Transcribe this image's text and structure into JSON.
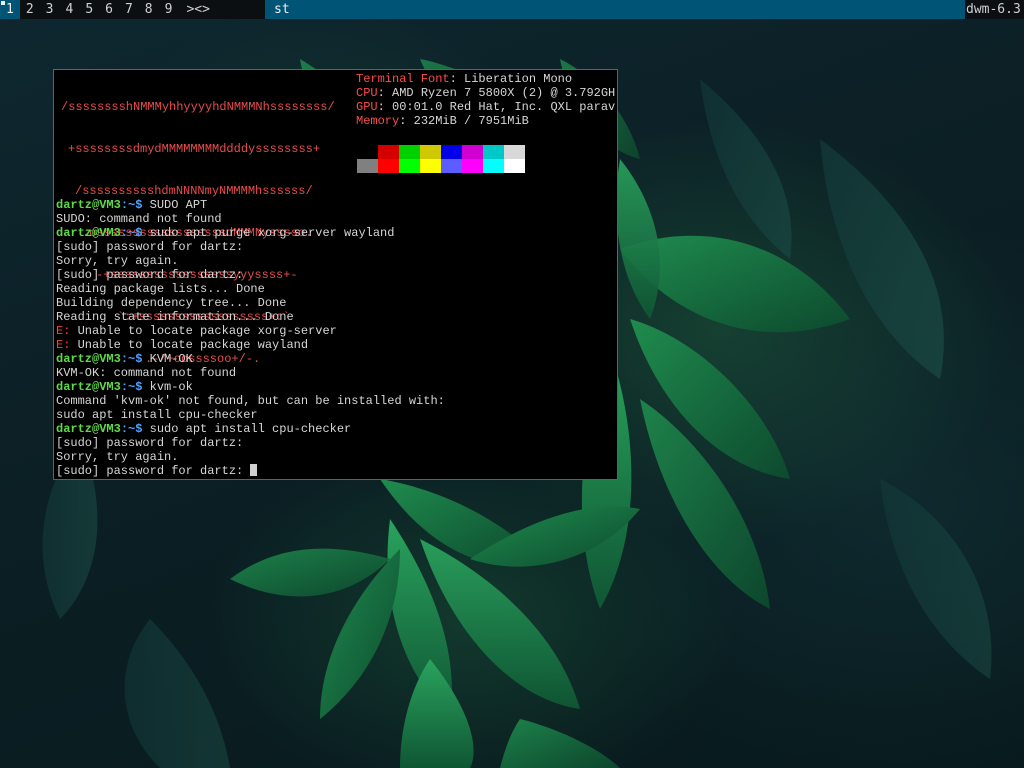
{
  "bar": {
    "tags": [
      "1",
      "2",
      "3",
      "4",
      "5",
      "6",
      "7",
      "8",
      "9"
    ],
    "active_tag": 0,
    "layout_symbol": "><>",
    "window_title": "st",
    "status_text": "dwm-6.3"
  },
  "colors": {
    "bar_selected": "#005577",
    "terminal_bg": "#000000",
    "logo_red": "#e84c4c",
    "prompt_user": "#5fd94a",
    "prompt_path": "#4da3ff",
    "error": "#ff3b3b"
  },
  "neofetch": {
    "logo_lines": [
      "/sssssssshNMMMyhhyyyyhdNMMMNhssssssss/",
      "+ssssssssdmydMMMMMMMMddddyssssssss+",
      "/sssssssssshdmNNNNmyNMMMMhssssss/",
      ".ossssssssssssssssssdMMMNysssso.",
      "-+sssssssssssssssssyyyssss+-",
      "`:+ssssssssssssssssss+:`",
      ".-/+oossssoo+/-."
    ],
    "info": [
      {
        "key": "Terminal Font",
        "value": ": Liberation Mono"
      },
      {
        "key": "CPU",
        "value": ": AMD Ryzen 7 5800X (2) @ 3.792GH"
      },
      {
        "key": "GPU",
        "value": ": 00:01.0 Red Hat, Inc. QXL parav"
      },
      {
        "key": "Memory",
        "value": ": 232MiB / 7951MiB"
      }
    ],
    "palette_top": [
      "#000000",
      "#d40000",
      "#00d000",
      "#d0c800",
      "#0000e8",
      "#d000d0",
      "#00c8c8",
      "#d8d8d8"
    ],
    "palette_bottom": [
      "#808080",
      "#ff0000",
      "#00ff00",
      "#ffff00",
      "#5c5cff",
      "#ff00ff",
      "#00ffff",
      "#ffffff"
    ]
  },
  "terminal": {
    "prompt_user": "dartz@VM3",
    "prompt_path": ":~$",
    "lines": [
      {
        "type": "prompt",
        "cmd": " SUDO APT"
      },
      {
        "type": "out",
        "text": "SUDO: command not found"
      },
      {
        "type": "prompt",
        "cmd": " sudo apt purge xorg-server wayland"
      },
      {
        "type": "out",
        "text": "[sudo] password for dartz:"
      },
      {
        "type": "out",
        "text": "Sorry, try again."
      },
      {
        "type": "out",
        "text": "[sudo] password for dartz:"
      },
      {
        "type": "out",
        "text": "Reading package lists... Done"
      },
      {
        "type": "out",
        "text": "Building dependency tree... Done"
      },
      {
        "type": "out",
        "text": "Reading state information... Done"
      },
      {
        "type": "err",
        "tag": "E:",
        "text": " Unable to locate package xorg-server"
      },
      {
        "type": "err",
        "tag": "E:",
        "text": " Unable to locate package wayland"
      },
      {
        "type": "prompt",
        "cmd": " KVM-OK"
      },
      {
        "type": "out",
        "text": "KVM-OK: command not found"
      },
      {
        "type": "prompt",
        "cmd": " kvm-ok"
      },
      {
        "type": "out",
        "text": "Command 'kvm-ok' not found, but can be installed with:"
      },
      {
        "type": "out",
        "text": "sudo apt install cpu-checker"
      },
      {
        "type": "prompt",
        "cmd": " sudo apt install cpu-checker"
      },
      {
        "type": "out",
        "text": "[sudo] password for dartz:"
      },
      {
        "type": "out",
        "text": "Sorry, try again."
      },
      {
        "type": "out",
        "text": "[sudo] password for dartz: "
      }
    ]
  }
}
